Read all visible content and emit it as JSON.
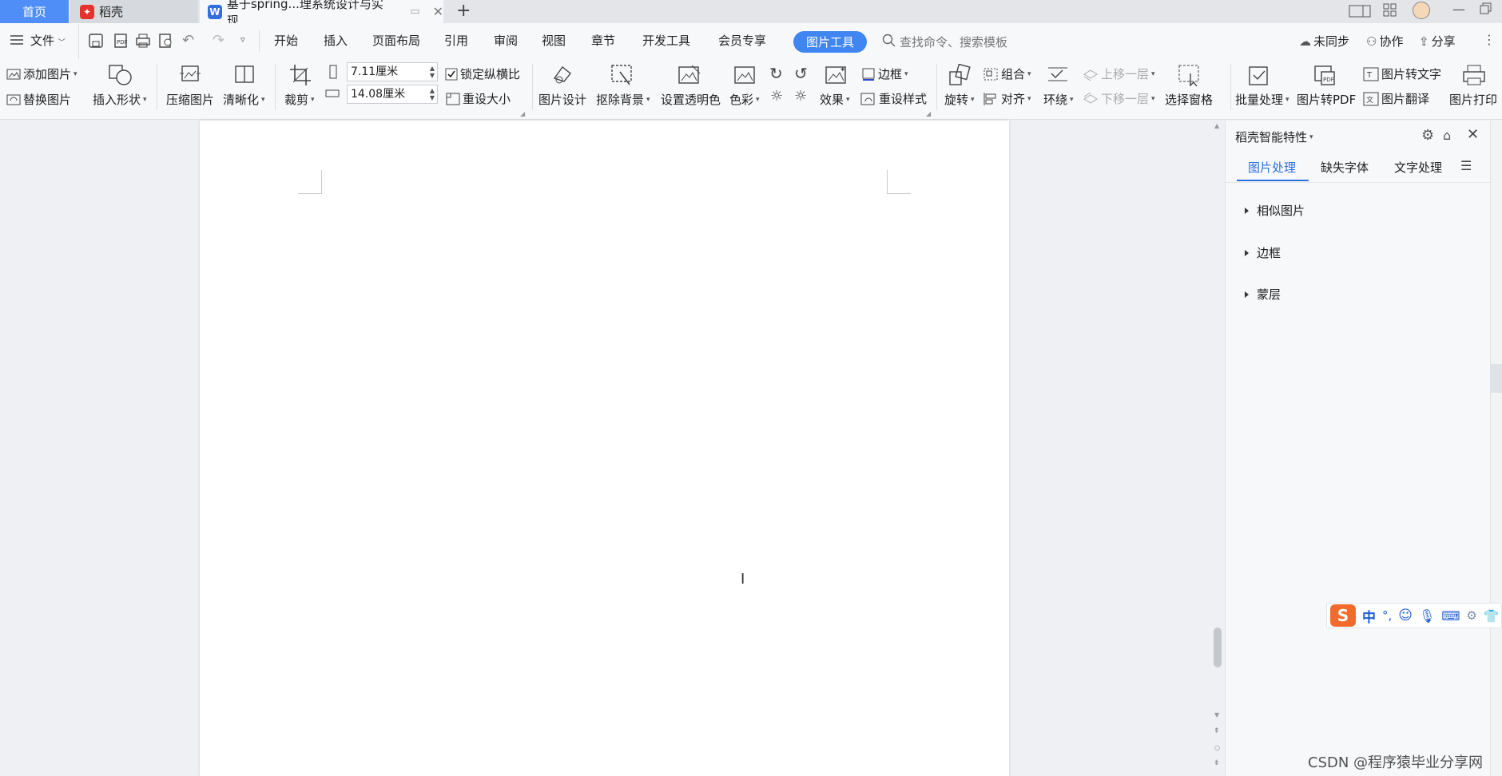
{
  "titlebar": {
    "tabs": [
      {
        "label": "首页"
      },
      {
        "label": "稻壳"
      },
      {
        "label": "基于spring...理系统设计与实现"
      }
    ],
    "add_tab": "+"
  },
  "menubar": {
    "file": "文件",
    "items": [
      "开始",
      "插入",
      "页面布局",
      "引用",
      "审阅",
      "视图",
      "章节",
      "开发工具",
      "会员专享"
    ],
    "active_tool": "图片工具",
    "search_placeholder": "查找命令、搜索模板",
    "right": {
      "sync": "未同步",
      "collab": "协作",
      "share": "分享"
    }
  },
  "ribbon": {
    "add_picture": "添加图片",
    "replace_picture": "替换图片",
    "insert_shape": "插入形状",
    "compress_picture": "压缩图片",
    "sharpen": "清晰化",
    "crop": "裁剪",
    "height_value": "7.11厘米",
    "width_value": "14.08厘米",
    "lock_ratio": "锁定纵横比",
    "reset_size": "重设大小",
    "picture_design": "图片设计",
    "remove_background": "抠除背景",
    "set_transparent": "设置透明色",
    "color": "色彩",
    "effects": "效果",
    "border": "边框",
    "reset_style": "重设样式",
    "rotate": "旋转",
    "group": "组合",
    "align": "对齐",
    "wrap": "环绕",
    "bring_forward": "上移一层",
    "send_backward": "下移一层",
    "selection_pane": "选择窗格",
    "batch": "批量处理",
    "to_pdf": "图片转PDF",
    "to_text": "图片转文字",
    "translate": "图片翻译",
    "print": "图片打印"
  },
  "panel": {
    "title": "稻壳智能特性",
    "tabs": [
      "图片处理",
      "缺失字体",
      "文字处理"
    ],
    "items": [
      "相似图片",
      "边框",
      "蒙层"
    ]
  },
  "ime": {
    "lang": "中",
    "punct": "°,"
  },
  "watermark": "CSDN @程序猿毕业分享网"
}
